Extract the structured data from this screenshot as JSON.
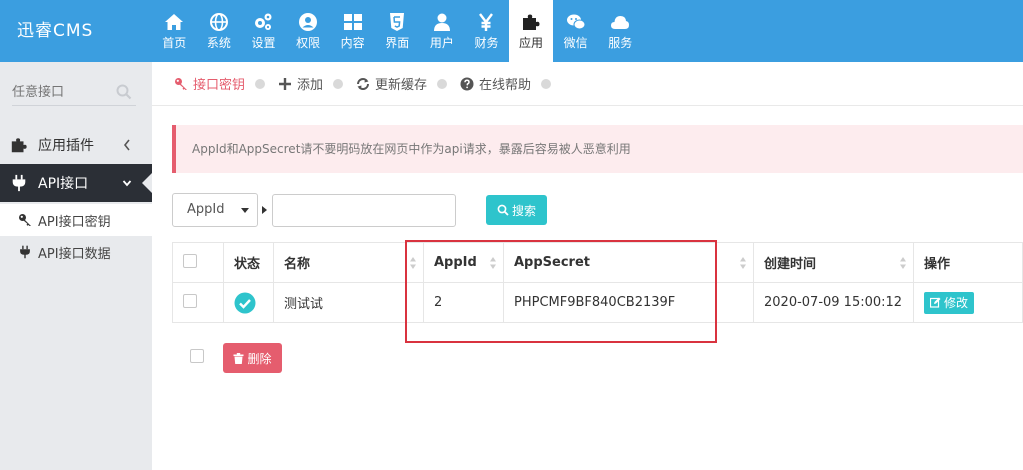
{
  "app": {
    "logo": "迅睿CMS"
  },
  "nav": [
    {
      "label": "首页",
      "icon": "home-icon"
    },
    {
      "label": "系统",
      "icon": "globe-icon"
    },
    {
      "label": "设置",
      "icon": "cogs-icon"
    },
    {
      "label": "权限",
      "icon": "user-circle-icon"
    },
    {
      "label": "内容",
      "icon": "grid-icon"
    },
    {
      "label": "界面",
      "icon": "html5-icon"
    },
    {
      "label": "用户",
      "icon": "user-icon"
    },
    {
      "label": "财务",
      "icon": "yen-icon"
    },
    {
      "label": "应用",
      "icon": "puzzle-icon",
      "active": true
    },
    {
      "label": "微信",
      "icon": "wechat-icon"
    },
    {
      "label": "服务",
      "icon": "cloud-icon"
    }
  ],
  "sidebar": {
    "search_placeholder": "任意接口",
    "groups": [
      {
        "label": "应用插件",
        "open": false
      },
      {
        "label": "API接口",
        "open": true
      }
    ],
    "subitems": [
      {
        "label": "API接口密钥",
        "current": true
      },
      {
        "label": "API接口数据",
        "current": false
      }
    ]
  },
  "toolbar": {
    "items": [
      {
        "label": "接口密钥",
        "icon": "key-icon",
        "active": true
      },
      {
        "label": "添加",
        "icon": "plus-icon"
      },
      {
        "label": "更新缓存",
        "icon": "refresh-icon"
      },
      {
        "label": "在线帮助",
        "icon": "question-icon"
      }
    ]
  },
  "alert": {
    "text": "AppId和AppSecret请不要明码放在网页中作为api请求，暴露后容易被人恶意利用"
  },
  "filter": {
    "select_value": "AppId",
    "search_label": "搜索"
  },
  "table": {
    "headers": [
      "状态",
      "名称",
      "AppId",
      "AppSecret",
      "创建时间",
      "操作"
    ],
    "rows": [
      {
        "name": "测试试",
        "appid": "2",
        "appsecret": "PHPCMF9BF840CB2139F",
        "created": "2020-07-09 15:00:12",
        "action": "修改"
      }
    ]
  },
  "actions": {
    "delete_label": "删除"
  },
  "colors": {
    "topbar": "#3b9ee0",
    "accent": "#2ec4cc",
    "danger": "#e55d6e"
  }
}
